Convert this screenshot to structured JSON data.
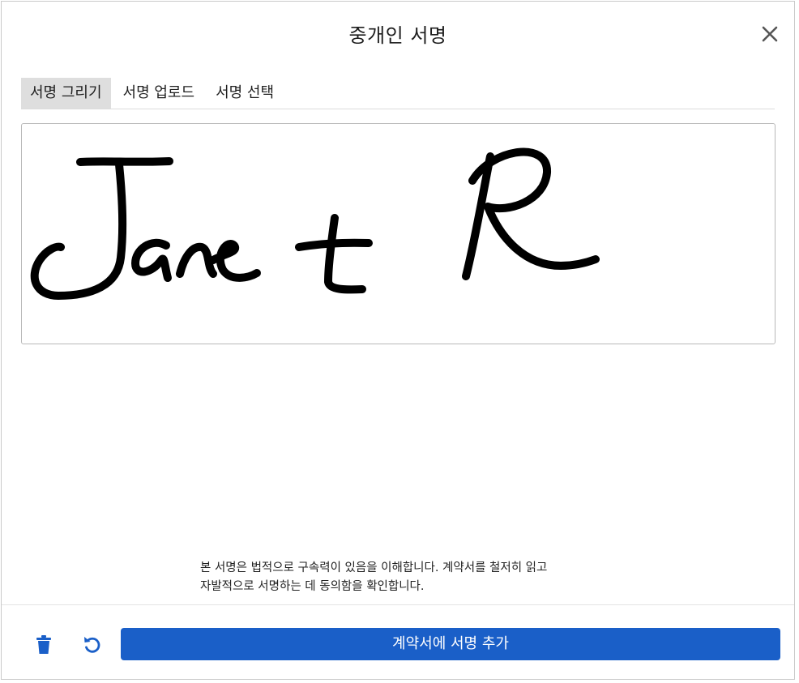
{
  "dialog": {
    "title": "중개인 서명",
    "close_icon": "close-icon"
  },
  "tabs": [
    {
      "label": "서명 그리기",
      "active": true
    },
    {
      "label": "서명 업로드",
      "active": false
    },
    {
      "label": "서명 선택",
      "active": false
    }
  ],
  "signature_pad": {
    "stroke_color": "#000000",
    "has_signature": true
  },
  "disclaimer": {
    "line1": "본 서명은 법적으로 구속력이 있음을 이해합니다. 계약서를 철저히 읽고",
    "line2": "자발적으로 서명하는 데 동의함을 확인합니다."
  },
  "footer": {
    "trash_icon": "trash-icon",
    "undo_icon": "undo-icon",
    "primary_label": "계약서에 서명 추가"
  },
  "colors": {
    "primary": "#1a5fc8",
    "icon_blue": "#1a5fc8",
    "active_tab_bg": "#dedede"
  }
}
